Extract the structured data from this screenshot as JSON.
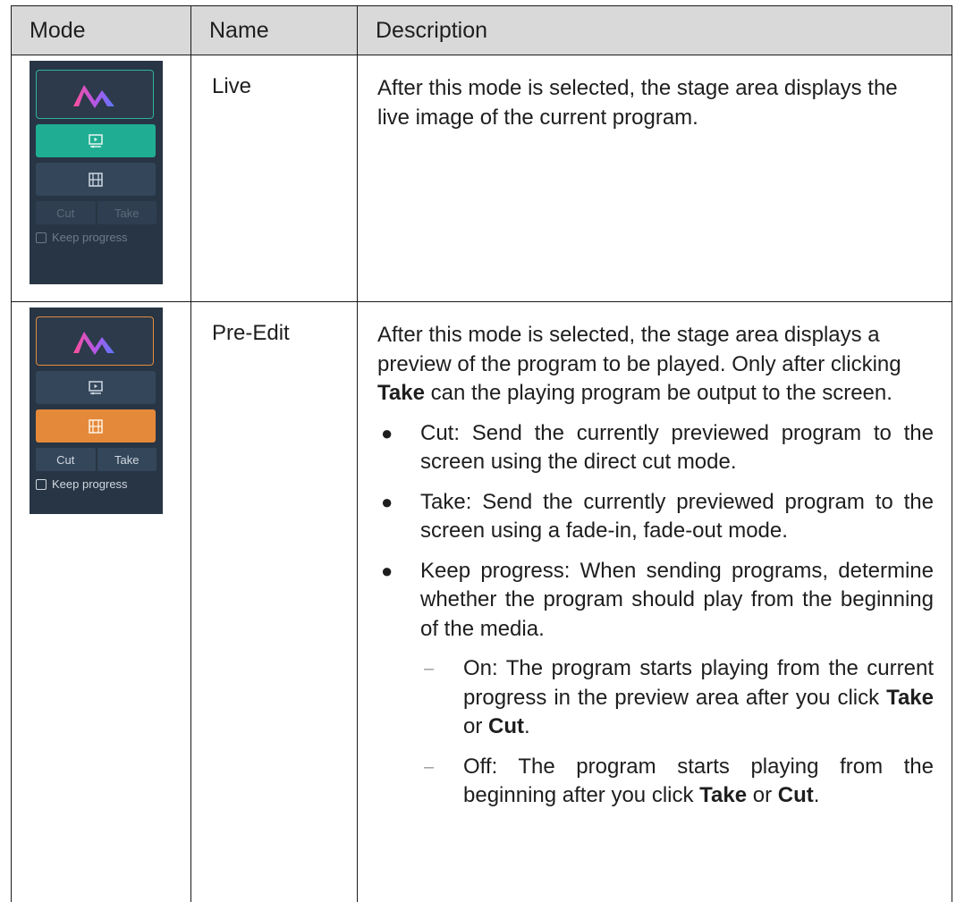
{
  "table": {
    "headers": {
      "mode": "Mode",
      "name": "Name",
      "description": "Description"
    },
    "rows": [
      {
        "name": "Live",
        "description": "After this mode is selected, the stage area displays the live image of the current program.",
        "panel": {
          "cut_label": "Cut",
          "take_label": "Take",
          "keep_label": "Keep progress",
          "state": "live",
          "accent": "#1fae93"
        }
      },
      {
        "name": "Pre-Edit",
        "intro_parts": [
          "After this mode is selected, the stage area displays a preview of the program to be played. Only after clicking ",
          "Take",
          " can the playing program be output to the screen."
        ],
        "bullets": [
          "Cut: Send the currently previewed program to the screen using the direct cut mode.",
          "Take: Send the currently previewed program to the screen using a fade-in, fade-out mode.",
          "Keep progress: When sending programs, determine whether the program should play from the beginning of the media."
        ],
        "sub_bullets": [
          {
            "text1": "On: The program starts playing from the current progress in the preview area after you click ",
            "b1": "Take",
            "mid": " or ",
            "b2": "Cut",
            "end": "."
          },
          {
            "text1": "Off: The program starts playing from the beginning after you click ",
            "b1": "Take",
            "mid": " or ",
            "b2": "Cut",
            "end": "."
          }
        ],
        "panel": {
          "cut_label": "Cut",
          "take_label": "Take",
          "keep_label": "Keep progress",
          "state": "pre-edit",
          "accent": "#e4893a"
        }
      }
    ]
  },
  "icons": {
    "logo": "app-logo-icon",
    "live": "monitor-play-icon",
    "preedit": "film-grid-icon",
    "bullet": "bullet-dot",
    "dash": "dash"
  }
}
